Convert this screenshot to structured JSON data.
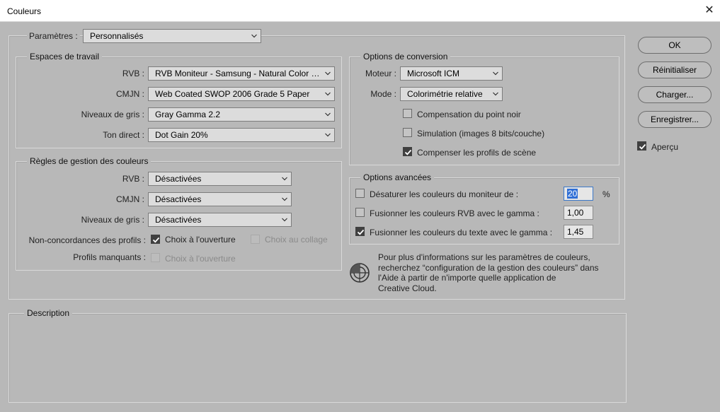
{
  "window": {
    "title": "Couleurs",
    "close_glyph": "✕"
  },
  "settings": {
    "label": "Paramètres :",
    "value": "Personnalisés"
  },
  "workspaces": {
    "legend": "Espaces de travail",
    "rows": [
      {
        "label": "RVB :",
        "value": "RVB Moniteur - Samsung - Natural Color P..."
      },
      {
        "label": "CMJN :",
        "value": "Web Coated SWOP 2006 Grade 5 Paper"
      },
      {
        "label": "Niveaux de gris :",
        "value": "Gray Gamma 2.2"
      },
      {
        "label": "Ton direct :",
        "value": "Dot Gain 20%"
      }
    ]
  },
  "policies": {
    "legend": "Règles de gestion des couleurs",
    "rows": [
      {
        "label": "RVB :",
        "value": "Désactivées"
      },
      {
        "label": "CMJN :",
        "value": "Désactivées"
      },
      {
        "label": "Niveaux de gris :",
        "value": "Désactivées"
      }
    ],
    "mismatch_label": "Non-concordances des profils :",
    "mismatch_open": {
      "label": "Choix à l'ouverture",
      "checked": true
    },
    "mismatch_paste": {
      "label": "Choix au collage",
      "checked": false
    },
    "missing_label": "Profils manquants :",
    "missing_open": {
      "label": "Choix à l'ouverture",
      "checked": false
    }
  },
  "conversion": {
    "legend": "Options de conversion",
    "engine_label": "Moteur :",
    "engine_value": "Microsoft ICM",
    "mode_label": "Mode :",
    "mode_value": "Colorimétrie relative",
    "black_point": {
      "label": "Compensation du point noir",
      "checked": false
    },
    "dither": {
      "label": "Simulation (images 8 bits/couche)",
      "checked": false
    },
    "scene": {
      "label": "Compenser les profils de scène",
      "checked": true
    }
  },
  "advanced": {
    "legend": "Options avancées",
    "desaturate": {
      "label": "Désaturer les couleurs du moniteur de :",
      "checked": false,
      "value": "20",
      "unit": "%"
    },
    "blend_rgb": {
      "label": "Fusionner les couleurs RVB avec le gamma :",
      "checked": false,
      "value": "1,00"
    },
    "blend_text": {
      "label": "Fusionner les couleurs du texte avec le gamma :",
      "checked": true,
      "value": "1,45"
    }
  },
  "info": {
    "lines": [
      "Pour plus d'informations sur les paramètres de couleurs,",
      "recherchez “configuration de la gestion des couleurs” dans",
      "l'Aide à partir de n'importe quelle application de",
      "Creative Cloud."
    ]
  },
  "description": {
    "legend": "Description"
  },
  "buttons": {
    "ok": "OK",
    "reset": "Réinitialiser",
    "load": "Charger...",
    "save": "Enregistrer..."
  },
  "preview": {
    "label": "Aperçu",
    "checked": true
  }
}
